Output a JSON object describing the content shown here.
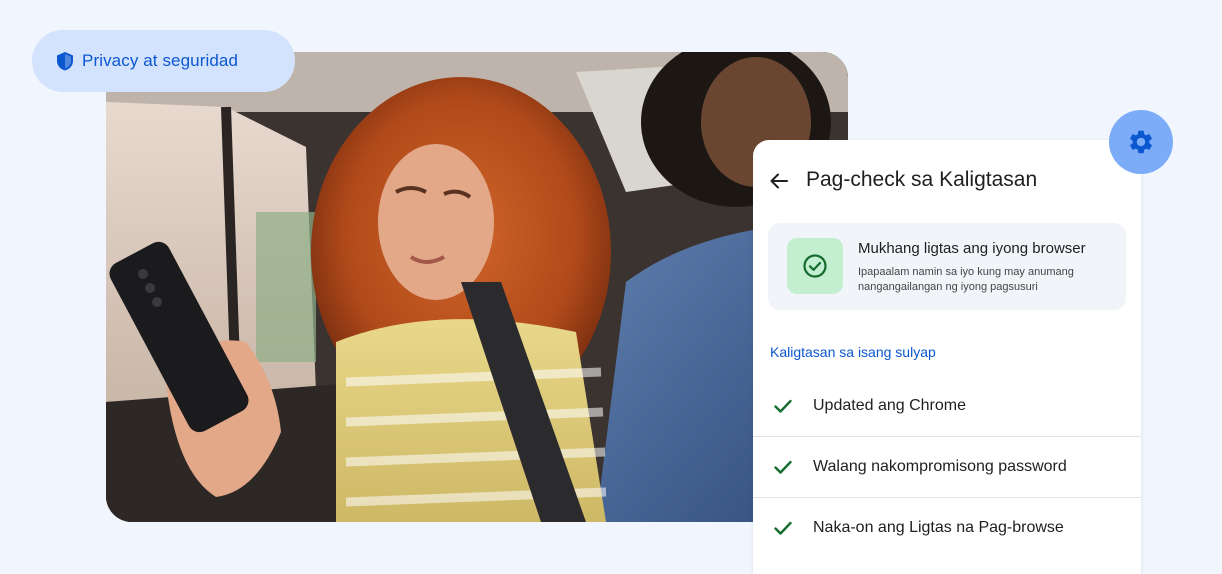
{
  "badge": {
    "label": "Privacy at seguridad",
    "icon": "shield-icon",
    "accent": "#0b57d0",
    "background": "#d3e3fd"
  },
  "photo": {
    "icon": "photo"
  },
  "settings": {
    "icon": "gear-icon",
    "background": "#7cacf8"
  },
  "safety_check": {
    "back_icon": "arrow-back-icon",
    "title": "Pag-check sa Kaligtasan",
    "status": {
      "icon": "check-circle-icon",
      "title": "Mukhang ligtas ang iyong browser",
      "description": "Ipapaalam namin sa iyo kung may anumang nangangailangan ng iyong pagsusuri"
    },
    "section_title": "Kaligtasan sa isang sulyap",
    "items": [
      {
        "icon": "check-icon",
        "label": "Updated ang Chrome"
      },
      {
        "icon": "check-icon",
        "label": "Walang nakompromisong password"
      },
      {
        "icon": "check-icon",
        "label": "Naka-on ang Ligtas na Pag-browse"
      }
    ],
    "check_color": "#146c2e"
  }
}
